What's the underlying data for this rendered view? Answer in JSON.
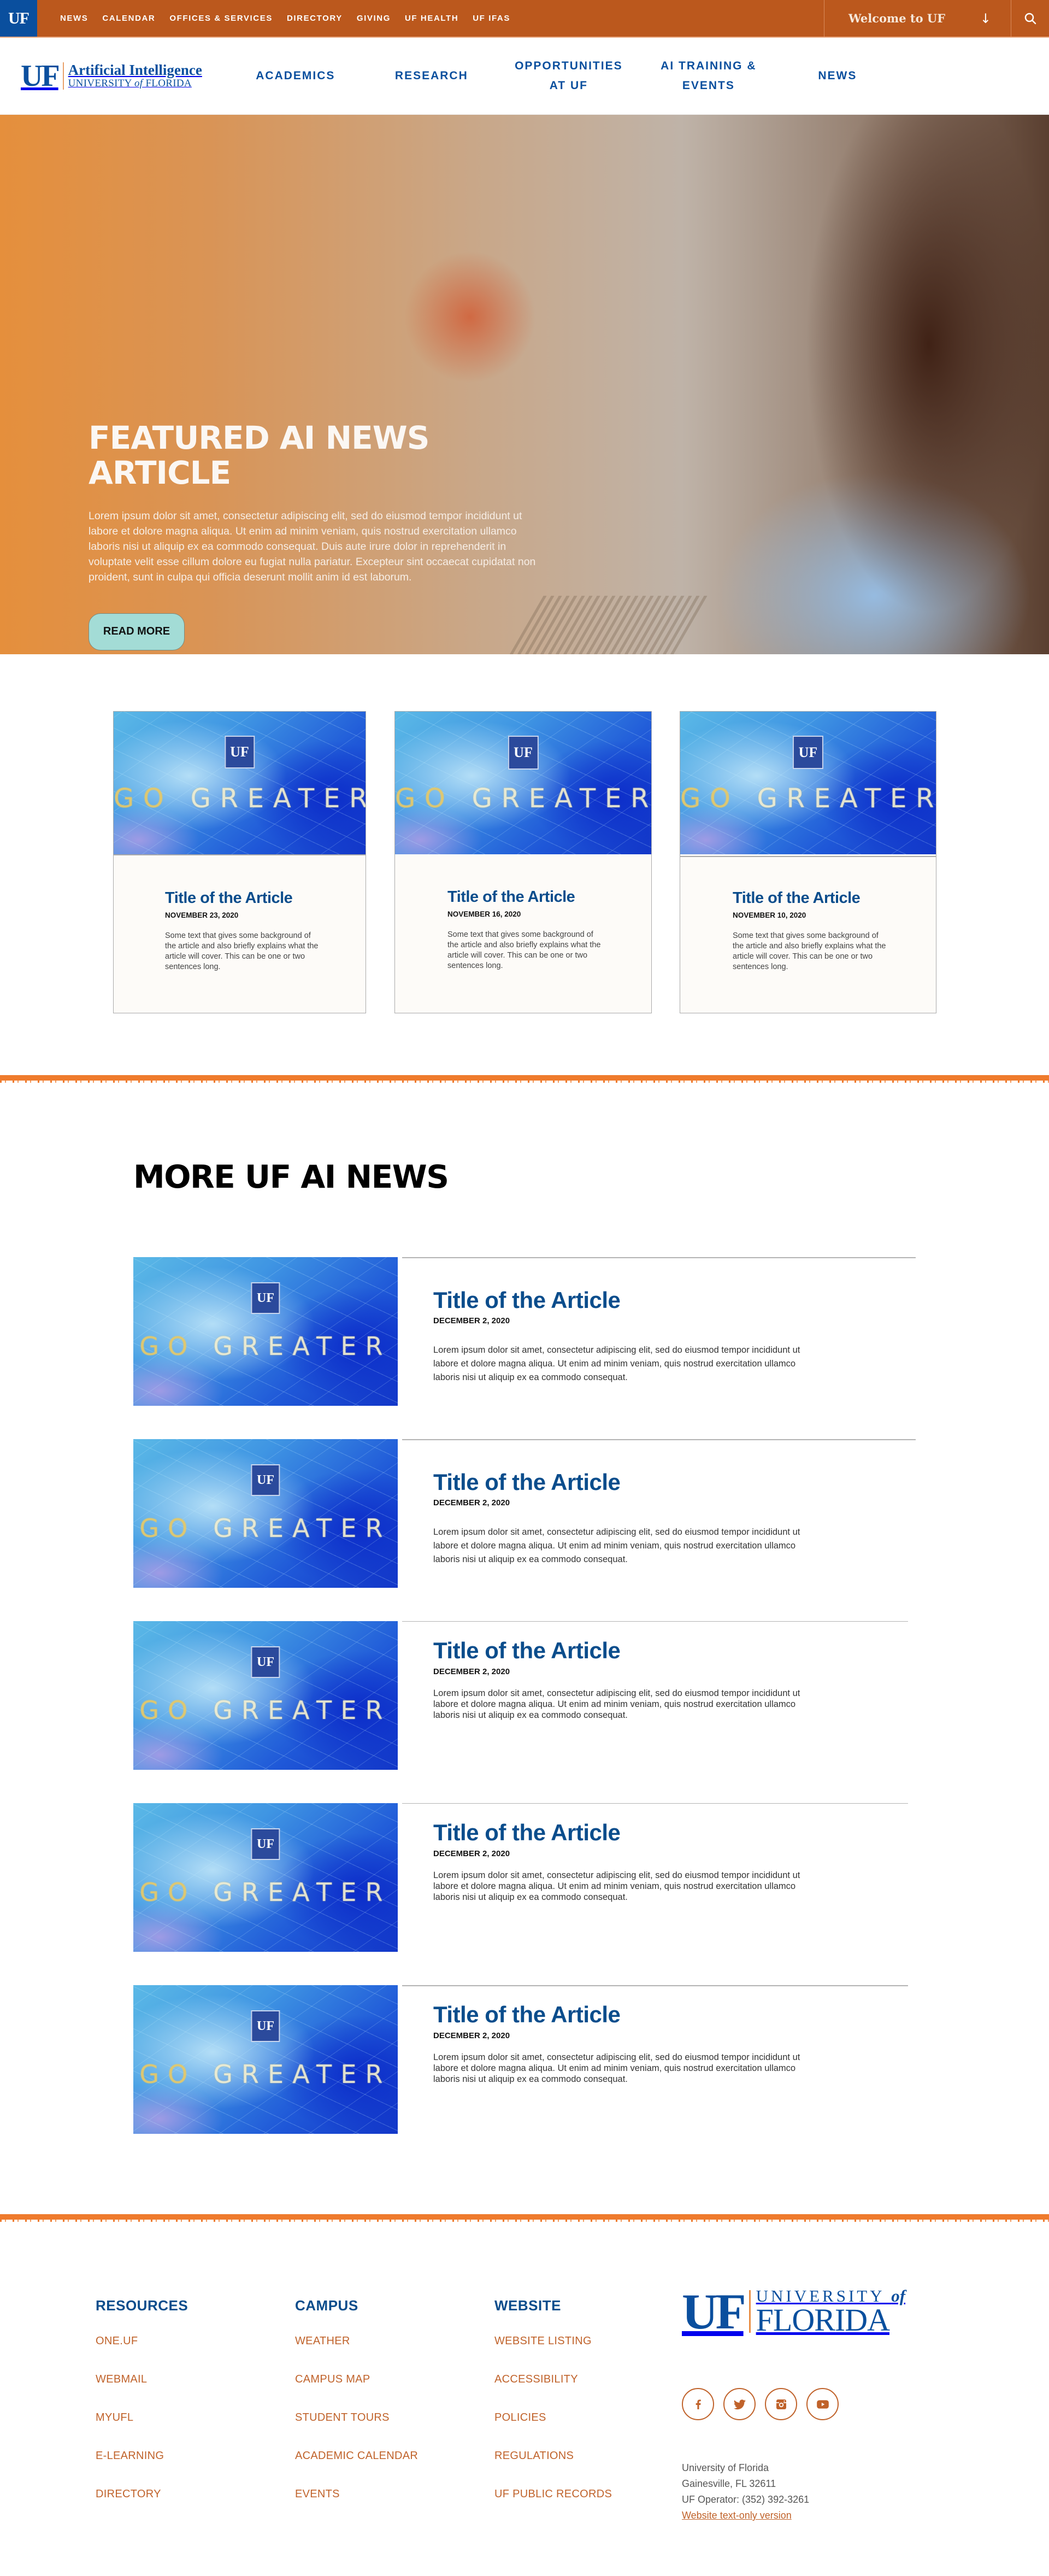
{
  "topbar": {
    "logo": "UF",
    "links": [
      "NEWS",
      "CALENDAR",
      "OFFICES & SERVICES",
      "DIRECTORY",
      "GIVING",
      "UF HEALTH",
      "UF IFAS"
    ],
    "welcome": "Welcome to UF",
    "welcome_arrow": "↓"
  },
  "mainnav": {
    "logo": {
      "uf": "UF",
      "line1": "Artificial Intelligence",
      "line2_pre": "UNIVERSITY ",
      "line2_of": "of",
      "line2_post": " FLORIDA"
    },
    "items": [
      {
        "label": "ACADEMICS"
      },
      {
        "label": "RESEARCH"
      },
      {
        "label": "OPPORTUNITIES AT UF",
        "line1": "OPPORTUNITIES",
        "line2": "AT UF"
      },
      {
        "label": "AI TRAINING & EVENTS",
        "line1": "AI TRAINING &",
        "line2": "EVENTS"
      },
      {
        "label": "NEWS"
      }
    ]
  },
  "hero": {
    "title": "FEATURED AI NEWS ARTICLE",
    "body": "Lorem ipsum dolor sit amet, consectetur adipiscing elit, sed do eiusmod tempor incididunt ut labore et dolore magna aliqua. Ut enim ad minim veniam, quis nostrud exercitation ullamco laboris nisi ut aliquip ex ea commodo consequat. Duis aute irure dolor in reprehenderit in voluptate velit esse cillum dolore eu fugiat nulla pariatur. Excepteur sint occaecat cupidatat non proident, sunt in culpa qui officia deserunt mollit anim id est laborum.",
    "button": "READ MORE"
  },
  "image_text": {
    "uf": "UF",
    "go": "GO ",
    "greater": "GREATER"
  },
  "featured_cards": [
    {
      "title": "Title of the Article",
      "date": "NOVEMBER 23, 2020",
      "desc": "Some text that gives some background of the article and also briefly explains what the article will cover. This can be one or two sentences long."
    },
    {
      "title": "Title of the Article",
      "date": "NOVEMBER 16, 2020",
      "desc": "Some text that gives some background of the article and also briefly explains what the article will cover. This can be one or two sentences long."
    },
    {
      "title": "Title of the Article",
      "date": "NOVEMBER 10, 2020",
      "desc": "Some text that gives some background of the article and also briefly explains what the article will cover. This can be one or two sentences long."
    }
  ],
  "more_news": {
    "heading": "MORE UF AI NEWS",
    "items": [
      {
        "title": "Title of the Article",
        "date": "DECEMBER 2, 2020",
        "desc": "Lorem ipsum dolor sit amet, consectetur adipiscing elit, sed do eiusmod tempor incididunt ut labore et dolore magna aliqua. Ut enim ad minim veniam, quis nostrud exercitation ullamco laboris nisi ut aliquip ex ea commodo consequat."
      },
      {
        "title": "Title of the Article",
        "date": "DECEMBER 2, 2020",
        "desc": "Lorem ipsum dolor sit amet, consectetur adipiscing elit, sed do eiusmod tempor incididunt ut labore et dolore magna aliqua. Ut enim ad minim veniam, quis nostrud exercitation ullamco laboris nisi ut aliquip ex ea commodo consequat."
      },
      {
        "title": "Title of the Article",
        "date": "DECEMBER 2, 2020",
        "desc": "Lorem ipsum dolor sit amet, consectetur adipiscing elit, sed do eiusmod tempor incididunt ut labore et dolore magna aliqua. Ut enim ad minim veniam, quis nostrud exercitation ullamco laboris nisi ut aliquip ex ea commodo consequat."
      },
      {
        "title": "Title of the Article",
        "date": "DECEMBER 2, 2020",
        "desc": "Lorem ipsum dolor sit amet, consectetur adipiscing elit, sed do eiusmod tempor incididunt ut labore et dolore magna aliqua. Ut enim ad minim veniam, quis nostrud exercitation ullamco laboris nisi ut aliquip ex ea commodo consequat."
      },
      {
        "title": "Title of the Article",
        "date": "DECEMBER 2, 2020",
        "desc": "Lorem ipsum dolor sit amet, consectetur adipiscing elit, sed do eiusmod tempor incididunt ut labore et dolore magna aliqua. Ut enim ad minim veniam, quis nostrud exercitation ullamco laboris nisi ut aliquip ex ea commodo consequat."
      }
    ]
  },
  "footer": {
    "columns": [
      {
        "heading": "RESOURCES",
        "links": [
          "ONE.UF",
          "WEBMAIL",
          "MYUFL",
          "E-LEARNING",
          "DIRECTORY"
        ]
      },
      {
        "heading": "CAMPUS",
        "links": [
          "WEATHER",
          "CAMPUS MAP",
          "STUDENT TOURS",
          "ACADEMIC CALENDAR",
          "EVENTS"
        ]
      },
      {
        "heading": "WEBSITE",
        "links": [
          "WEBSITE LISTING",
          "ACCESSIBILITY",
          "POLICIES",
          "REGULATIONS",
          "UF PUBLIC RECORDS"
        ]
      }
    ],
    "brand": {
      "uf": "UF",
      "line1": "UNIVERSITY ",
      "line1_of": "of",
      "line2": "FLORIDA"
    },
    "social": [
      "facebook",
      "twitter",
      "instagram",
      "youtube"
    ],
    "address": [
      "University of Florida",
      "Gainesville, FL 32611",
      "UF Operator: (352) 392-3261"
    ],
    "text_only_link": "Website text-only version"
  },
  "colors": {
    "orange": "#bb581d",
    "blue": "#0a4f9e",
    "accent_orange": "#ef7b2d",
    "button_teal": "#a3dcd6",
    "link_orange": "#c0622a"
  }
}
